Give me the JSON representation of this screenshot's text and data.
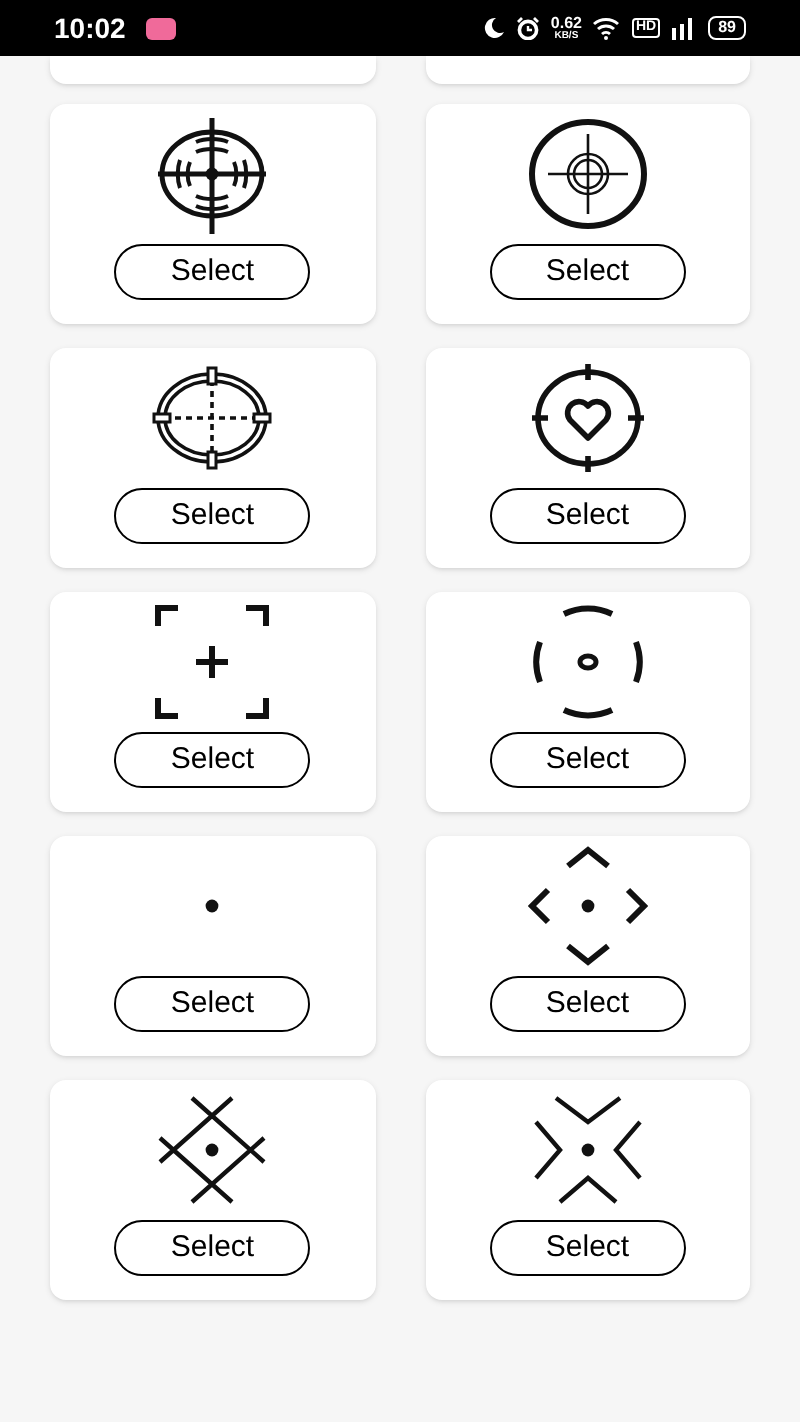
{
  "status_bar": {
    "time": "10:02",
    "speed_value": "0.62",
    "speed_unit": "KB/S",
    "hd_label": "HD",
    "battery": "89"
  },
  "cards": [
    {
      "kind": "scope",
      "button": "Select"
    },
    {
      "kind": "ring-dot",
      "button": "Select"
    },
    {
      "kind": "dashed-oval",
      "button": "Select"
    },
    {
      "kind": "heart",
      "button": "Select"
    },
    {
      "kind": "brackets",
      "button": "Select"
    },
    {
      "kind": "arc-ring",
      "button": "Select"
    },
    {
      "kind": "dot",
      "button": "Select"
    },
    {
      "kind": "diamond",
      "button": "Select"
    },
    {
      "kind": "lattice",
      "button": "Select"
    },
    {
      "kind": "chevrons",
      "button": "Select"
    }
  ]
}
